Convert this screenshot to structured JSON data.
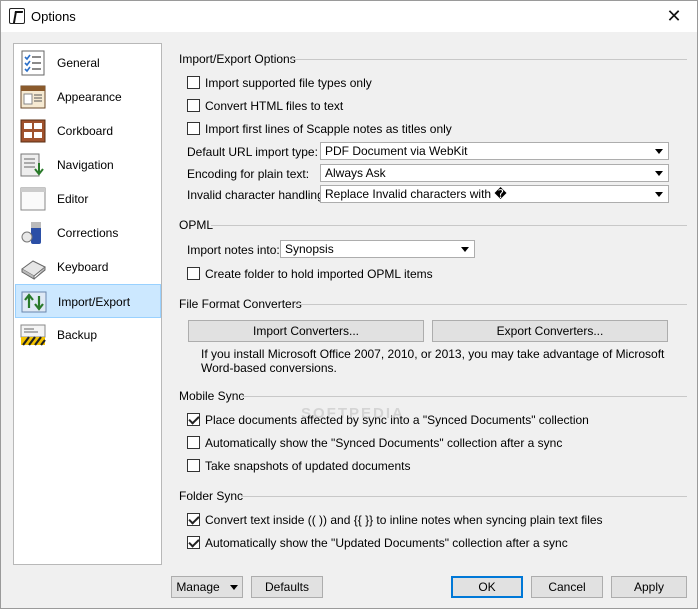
{
  "window": {
    "title": "Options"
  },
  "sidebar": {
    "items": [
      {
        "label": "General",
        "icon": "general-list-icon"
      },
      {
        "label": "Appearance",
        "icon": "appearance-icon"
      },
      {
        "label": "Corkboard",
        "icon": "corkboard-icon"
      },
      {
        "label": "Navigation",
        "icon": "navigation-icon"
      },
      {
        "label": "Editor",
        "icon": "editor-icon"
      },
      {
        "label": "Corrections",
        "icon": "corrections-icon"
      },
      {
        "label": "Keyboard",
        "icon": "keyboard-icon"
      },
      {
        "label": "Import/Export",
        "icon": "import-export-icon",
        "selected": true
      },
      {
        "label": "Backup",
        "icon": "backup-icon"
      }
    ]
  },
  "import_export": {
    "title": "Import/Export Options",
    "import_supported": {
      "label": "Import supported file types only",
      "checked": false
    },
    "convert_html": {
      "label": "Convert HTML files to text",
      "checked": false
    },
    "import_first_lines": {
      "label": "Import first lines of Scapple notes as titles only",
      "checked": false
    },
    "default_url_label": "Default URL import type:",
    "default_url_value": "PDF Document via WebKit",
    "encoding_label": "Encoding for plain text:",
    "encoding_value": "Always Ask",
    "invalid_char_label": "Invalid character handling:",
    "invalid_char_value": "Replace Invalid characters with �"
  },
  "opml": {
    "title": "OPML",
    "import_into_label": "Import notes into:",
    "import_into_value": "Synopsis",
    "create_folder": {
      "label": "Create folder to hold imported OPML items",
      "checked": false
    }
  },
  "converters": {
    "title": "File Format Converters",
    "import_button": "Import Converters...",
    "export_button": "Export Converters...",
    "info_text": "If you install Microsoft Office 2007, 2010, or 2013, you may take advantage of Microsoft Word-based conversions."
  },
  "mobile_sync": {
    "title": "Mobile Sync",
    "place_documents": {
      "label": "Place documents affected by sync into a \"Synced Documents\" collection",
      "checked": true
    },
    "auto_show": {
      "label": "Automatically show the \"Synced Documents\" collection after a sync",
      "checked": false
    },
    "snapshots": {
      "label": "Take snapshots of updated documents",
      "checked": false
    }
  },
  "folder_sync": {
    "title": "Folder Sync",
    "convert_text": {
      "label": "Convert text inside (( )) and {{ }} to inline notes when syncing plain text files",
      "checked": true
    },
    "auto_show_updated": {
      "label": "Automatically show the \"Updated Documents\" collection after a sync",
      "checked": true
    }
  },
  "footer": {
    "manage": "Manage",
    "defaults": "Defaults",
    "ok": "OK",
    "cancel": "Cancel",
    "apply": "Apply"
  },
  "watermark": "SOFTPEDIA",
  "colors": {
    "selection": "#cce8ff",
    "default_button_border": "#0078d7"
  }
}
